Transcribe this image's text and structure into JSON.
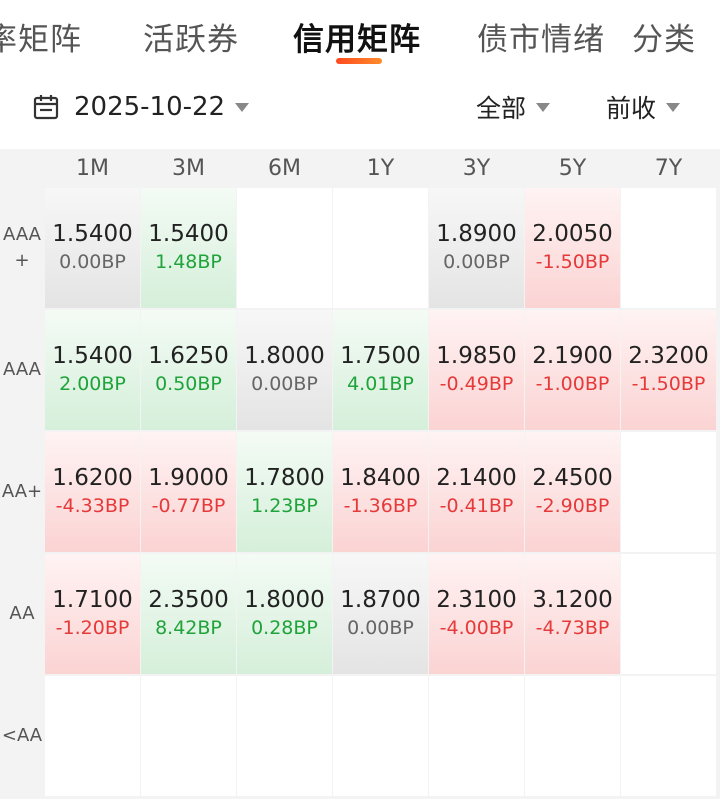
{
  "tabs": [
    {
      "label": "率矩阵",
      "active": false
    },
    {
      "label": "活跃券",
      "active": false
    },
    {
      "label": "信用矩阵",
      "active": true
    },
    {
      "label": "债市情绪",
      "active": false
    },
    {
      "label": "分类",
      "active": false
    }
  ],
  "filter": {
    "date": "2025-10-22",
    "scope": "全部",
    "price_type": "前收"
  },
  "matrix": {
    "terms": [
      "1M",
      "3M",
      "6M",
      "1Y",
      "3Y",
      "5Y",
      "7Y"
    ],
    "ratings": [
      "AAA+",
      "AAA",
      "AA+",
      "AA",
      "<AA"
    ],
    "rows": [
      [
        {
          "value": "1.5400",
          "change": "0.00BP",
          "trend": "neutral"
        },
        {
          "value": "1.5400",
          "change": "1.48BP",
          "trend": "down"
        },
        null,
        null,
        {
          "value": "1.8900",
          "change": "0.00BP",
          "trend": "neutral"
        },
        {
          "value": "2.0050",
          "change": "-1.50BP",
          "trend": "up"
        },
        null
      ],
      [
        {
          "value": "1.5400",
          "change": "2.00BP",
          "trend": "down"
        },
        {
          "value": "1.6250",
          "change": "0.50BP",
          "trend": "down"
        },
        {
          "value": "1.8000",
          "change": "0.00BP",
          "trend": "neutral"
        },
        {
          "value": "1.7500",
          "change": "4.01BP",
          "trend": "down"
        },
        {
          "value": "1.9850",
          "change": "-0.49BP",
          "trend": "up"
        },
        {
          "value": "2.1900",
          "change": "-1.00BP",
          "trend": "up"
        },
        {
          "value": "2.3200",
          "change": "-1.50BP",
          "trend": "up"
        }
      ],
      [
        {
          "value": "1.6200",
          "change": "-4.33BP",
          "trend": "up"
        },
        {
          "value": "1.9000",
          "change": "-0.77BP",
          "trend": "up"
        },
        {
          "value": "1.7800",
          "change": "1.23BP",
          "trend": "down"
        },
        {
          "value": "1.8400",
          "change": "-1.36BP",
          "trend": "up"
        },
        {
          "value": "2.1400",
          "change": "-0.41BP",
          "trend": "up"
        },
        {
          "value": "2.4500",
          "change": "-2.90BP",
          "trend": "up"
        },
        null
      ],
      [
        {
          "value": "1.7100",
          "change": "-1.20BP",
          "trend": "up"
        },
        {
          "value": "2.3500",
          "change": "8.42BP",
          "trend": "down"
        },
        {
          "value": "1.8000",
          "change": "0.28BP",
          "trend": "down"
        },
        {
          "value": "1.8700",
          "change": "0.00BP",
          "trend": "neutral"
        },
        {
          "value": "2.3100",
          "change": "-4.00BP",
          "trend": "up"
        },
        {
          "value": "3.1200",
          "change": "-4.73BP",
          "trend": "up"
        },
        null
      ],
      [
        null,
        null,
        null,
        null,
        null,
        null,
        null
      ]
    ]
  },
  "colors": {
    "accent": "#ff5a1f",
    "up_text": "#e63a3a",
    "down_text": "#1fa33a",
    "neutral_text": "#666666"
  }
}
